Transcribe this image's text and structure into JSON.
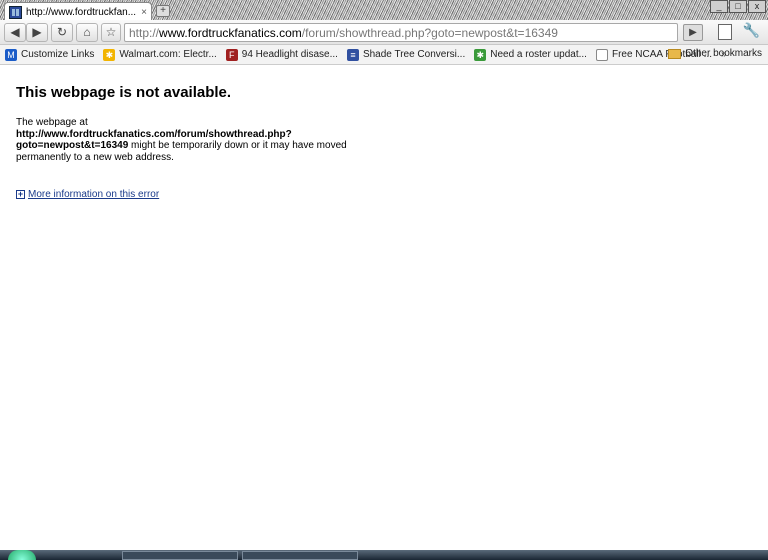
{
  "tab": {
    "title": "http://www.fordtruckfan...",
    "close": "×"
  },
  "newtab": "+",
  "window": {
    "minimize": "_",
    "maximize": "□",
    "close": "x"
  },
  "toolbar": {
    "back": "◀",
    "forward": "▶",
    "reload": "↻",
    "home": "⌂",
    "star": "☆",
    "url_prefix": "http://",
    "url_host": "www.fordtruckfanatics.com",
    "url_path": "/forum/showthread.php?goto=newpost&t=16349",
    "go": "▶",
    "wrench": "🔧"
  },
  "bookmarks": {
    "items": [
      {
        "label": "Customize Links",
        "icon": "M",
        "color": "#1b5cc8"
      },
      {
        "label": "Walmart.com: Electr...",
        "icon": "✱",
        "color": "#f2b400"
      },
      {
        "label": "94 Headlight disase...",
        "icon": "F",
        "color": "#a02020"
      },
      {
        "label": "Shade Tree Conversi...",
        "icon": "≡",
        "color": "#3050a0"
      },
      {
        "label": "Need a roster updat...",
        "icon": "✱",
        "color": "#3a9a3a"
      },
      {
        "label": "Free NCAA Football ...",
        "icon": "",
        "color": "#ffffff"
      }
    ],
    "more": "»",
    "other": "Other bookmarks"
  },
  "page": {
    "title": "This webpage is not available.",
    "body_prefix": "The webpage at ",
    "body_url": "http://www.fordtruckfanatics.com/forum/showthread.php?goto=newpost&t=16349",
    "body_suffix": " might be temporarily down or it may have moved permanently to a new web address.",
    "more_link": "More information on this error",
    "more_icon": "+"
  }
}
